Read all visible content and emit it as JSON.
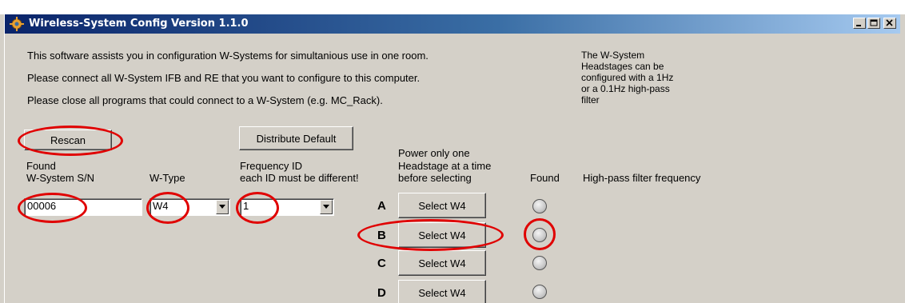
{
  "window": {
    "title": "Wireless-System Config Version 1.1.0",
    "minimize_glyph": "_",
    "maximize_glyph": "□",
    "close_glyph": "×"
  },
  "intro": {
    "line1": "This software assists you in configuration W-Systems for simultanious use in one room.",
    "line2": "Please connect all W-System IFB and RE that you want to configure to this computer.",
    "line3": "Please close all programs that could connect to a W-System (e.g. MC_Rack)."
  },
  "side_note": {
    "line1": "The W-System",
    "line2": "Headstages can be",
    "line3": "configured with a 1Hz",
    "line4": "or a 0.1Hz high-pass",
    "line5": "filter"
  },
  "buttons": {
    "rescan": "Rescan",
    "distribute_default": "Distribute Default"
  },
  "labels": {
    "found": "Found",
    "serial": "W-System S/N",
    "wtype": "W-Type",
    "freq_id": "Frequency ID",
    "freq_note": "each ID must be different!",
    "power_line1": "Power only one",
    "power_line2": "Headstage at a time",
    "power_line3": "before selecting",
    "found_col": "Found",
    "highpass": "High-pass filter frequency"
  },
  "row": {
    "serial_value": "00006",
    "wtype_value": "W4",
    "freq_value": "1"
  },
  "headstages": [
    {
      "letter": "A",
      "button": "Select W4"
    },
    {
      "letter": "B",
      "button": "Select W4"
    },
    {
      "letter": "C",
      "button": "Select W4"
    },
    {
      "letter": "D",
      "button": "Select W4"
    }
  ],
  "colors": {
    "highlight": "#e00000",
    "title_gradient_start": "#0a246a",
    "title_gradient_end": "#a6caf0",
    "face": "#d4d0c8"
  }
}
